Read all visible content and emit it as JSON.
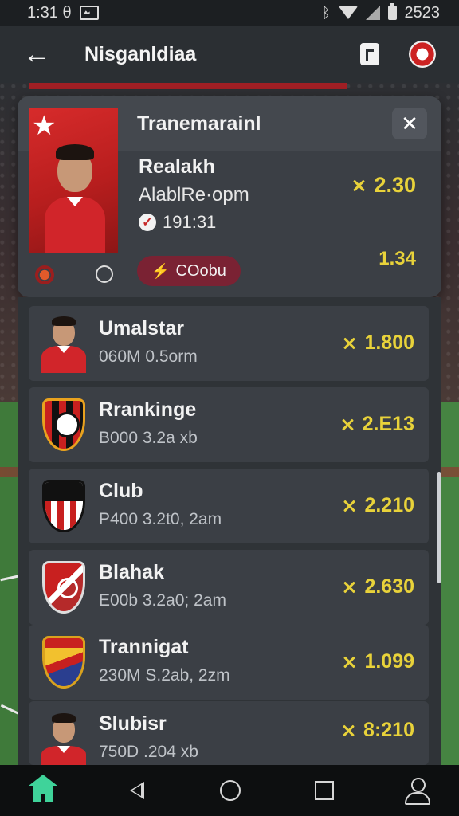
{
  "status_bar": {
    "time": "1:31 θ",
    "right_time": "2523"
  },
  "app_bar": {
    "title": "Nisganldiaa"
  },
  "feature_card": {
    "header": "Tranemarainl",
    "name": "Realakh",
    "subtitle": "AlablRe·opm",
    "check_text": "191:31",
    "price_primary": "2.30",
    "price_secondary": "1.34",
    "pill_label": "COobu"
  },
  "list": [
    {
      "name": "Umalstar",
      "detail": "060M 0.5orm",
      "price": "1.800",
      "thumb": "player"
    },
    {
      "name": "Rrankinge",
      "detail": "B000 3.2a xb",
      "price": "2.E13",
      "thumb": "crest-red-black"
    },
    {
      "name": "Club",
      "detail": "P400 3.2t0, 2am",
      "price": "2.210",
      "thumb": "crest-stripes"
    },
    {
      "name": "Blahak",
      "detail": "E00b 3.2a0; 2am",
      "price": "2.630",
      "thumb": "crest-red-white"
    },
    {
      "name": "Trannigat",
      "detail": "230M S.2ab, 2zm",
      "price": "1.099",
      "thumb": "crest-yellow-blue"
    },
    {
      "name": "Slubisr",
      "detail": "750D .204 xb",
      "price": "8:210",
      "thumb": "player"
    }
  ],
  "colors": {
    "accent_gold": "#e8d23a",
    "brand_red": "#c62828",
    "nav_home_green": "#3fd39a"
  }
}
